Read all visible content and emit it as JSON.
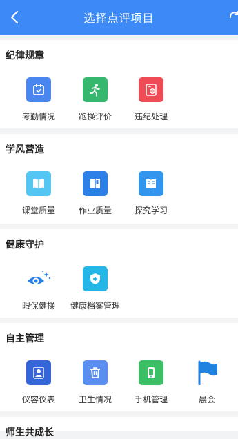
{
  "header": {
    "title": "选择点评项目"
  },
  "sections": [
    {
      "title": "纪律规章",
      "items": [
        {
          "label": "考勤情况",
          "icon": "calendar-check-icon",
          "color": "#4a86ef"
        },
        {
          "label": "跑操评价",
          "icon": "runner-icon",
          "color": "#35b76e"
        },
        {
          "label": "违纪处理",
          "icon": "violation-card-icon",
          "color": "#ee4b55"
        }
      ]
    },
    {
      "title": "学风营造",
      "items": [
        {
          "label": "课堂质量",
          "icon": "open-book-icon",
          "color": "#54c6f3"
        },
        {
          "label": "作业质量",
          "icon": "notebook-icon",
          "color": "#2d7fe8"
        },
        {
          "label": "探究学习",
          "icon": "book-icon",
          "color": "#3296ee"
        }
      ]
    },
    {
      "title": "健康守护",
      "items": [
        {
          "label": "眼保健操",
          "icon": "eye-sparkle-icon",
          "color": "#2a80e6"
        },
        {
          "label": "健康档案管理",
          "icon": "shield-plus-icon",
          "color": "#25b6e8"
        }
      ]
    },
    {
      "title": "自主管理",
      "items": [
        {
          "label": "仪容仪表",
          "icon": "person-portrait-icon",
          "color": "#3466d8"
        },
        {
          "label": "卫生情况",
          "icon": "trash-can-icon",
          "color": "#5a8fef"
        },
        {
          "label": "手机管理",
          "icon": "phone-icon",
          "color": "#3cbf64"
        },
        {
          "label": "晨会",
          "icon": "flag-icon",
          "color": "#1f82e0"
        }
      ]
    },
    {
      "title": "师生共成长",
      "items": []
    }
  ]
}
